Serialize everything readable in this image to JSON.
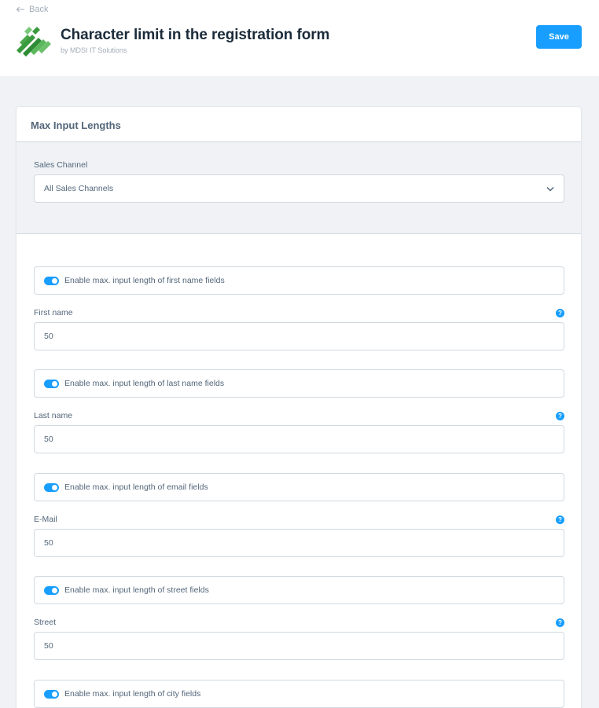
{
  "header": {
    "back_label": "Back",
    "title": "Character limit in the registration form",
    "subtitle": "by MDSI IT Solutions",
    "save_label": "Save",
    "logo_icon": "mdsi-logo-icon",
    "brand_color": "#189eff"
  },
  "card": {
    "title": "Max Input Lengths",
    "sales_channel": {
      "label": "Sales Channel",
      "selected": "All Sales Channels"
    },
    "fields": [
      {
        "toggle_label": "Enable max. input length of first name fields",
        "enabled": true,
        "label": "First name",
        "value": "50"
      },
      {
        "toggle_label": "Enable max. input length of last name fields",
        "enabled": true,
        "label": "Last name",
        "value": "50"
      },
      {
        "toggle_label": "Enable max. input length of email fields",
        "enabled": true,
        "label": "E-Mail",
        "value": "50"
      },
      {
        "toggle_label": "Enable max. input length of street fields",
        "enabled": true,
        "label": "Street",
        "value": "50"
      },
      {
        "toggle_label": "Enable max. input length of city fields",
        "enabled": true
      }
    ]
  }
}
